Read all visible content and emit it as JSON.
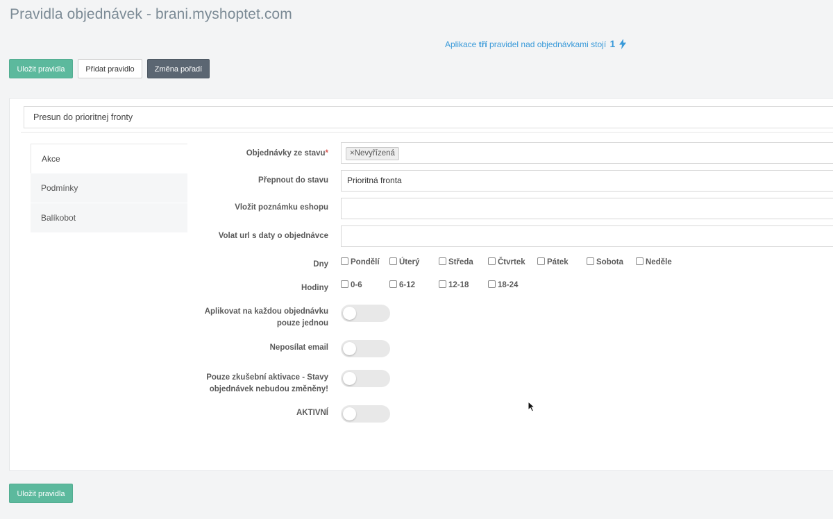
{
  "header": {
    "title": "Pravidla objednávek - brani.myshoptet.com",
    "cost_prefix": "Aplikace",
    "cost_bold": "tří",
    "cost_suffix": "pravidel nad objednávkami stojí",
    "cost_value": "1"
  },
  "toolbar": {
    "save_label": "Uložit pravidla",
    "add_label": "Přidat pravidlo",
    "reorder_label": "Změna pořadí"
  },
  "rule": {
    "name": "Presun do prioritnej fronty"
  },
  "tabs": [
    {
      "label": "Akce",
      "active": true
    },
    {
      "label": "Podmínky",
      "active": false
    },
    {
      "label": "Balíkobot",
      "active": false
    }
  ],
  "form": {
    "from_state_label": "Objednávky ze stavu",
    "from_state_required": "*",
    "from_state_tag": "Nevyřízená",
    "from_state_tag_remove": "×",
    "switch_to_label": "Přepnout do stavu",
    "switch_to_value": "Prioritná fronta",
    "note_label": "Vložit poznámku eshopu",
    "note_value": "",
    "url_label": "Volat url s daty o objednávce",
    "url_value": "",
    "days_label": "Dny",
    "days": [
      "Pondělí",
      "Úterý",
      "Středa",
      "Čtvrtek",
      "Pátek",
      "Sobota",
      "Neděle"
    ],
    "hours_label": "Hodiny",
    "hours": [
      "0-6",
      "6-12",
      "12-18",
      "18-24"
    ],
    "once_label_line1": "Aplikovat na každou objednávku",
    "once_label_line2": "pouze jednou",
    "no_email_label": "Neposílat email",
    "test_label_line1": "Pouze zkušební aktivace - Stavy",
    "test_label_line2": "objednávek nebudou změněny!",
    "active_label": "AKTIVNÍ",
    "toggles": {
      "once": false,
      "no_email": false,
      "test": false,
      "active": false
    }
  },
  "footer": {
    "save_label": "Uložit pravidla"
  },
  "colors": {
    "accent_green": "#5cb99d",
    "dark_button": "#5b6672",
    "link_blue": "#3a9ad9",
    "required_red": "#d9534f"
  }
}
